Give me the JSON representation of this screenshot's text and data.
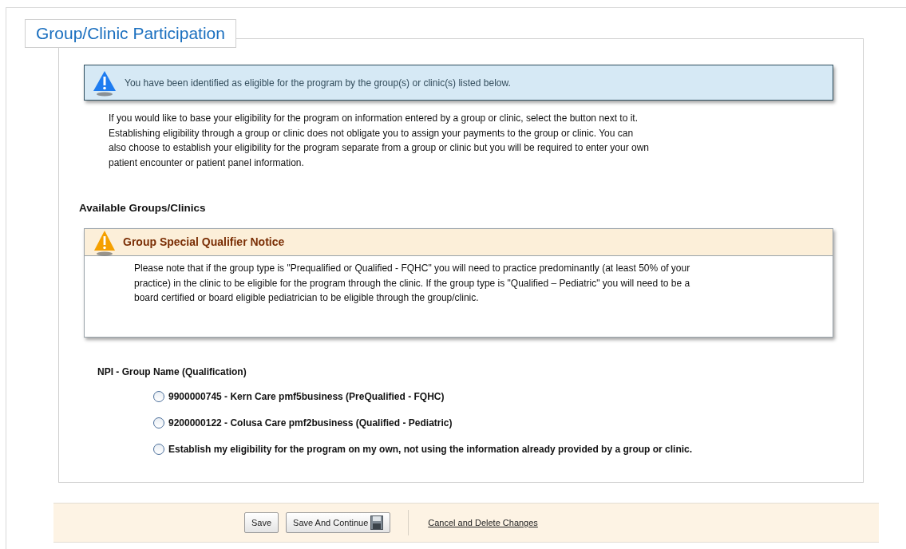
{
  "section_title": "Group/Clinic Participation",
  "info_message": "You have been identified as eligible for the program by the group(s) or clinic(s) listed below.",
  "intro_paragraph": "If you would like to base your eligibility for the program on information entered by a group or clinic, select the button next to it. Establishing eligibility through a group or clinic does not obligate you to assign your payments to the group or clinic. You can also choose to establish your eligibility for the program separate from a group or clinic but you will be required to enter your own patient encounter or patient panel information.",
  "available_heading": "Available Groups/Clinics",
  "notice": {
    "title": "Group Special Qualifier Notice",
    "body": "Please note that if the group type is \"Prequalified or Qualified - FQHC\" you will need to practice predominantly (at least 50% of your practice) in the clinic to be eligible for the program through the clinic. If the group type is \"Qualified – Pediatric\" you will need to be a board certified or board eligible pediatrician to be eligible through the group/clinic."
  },
  "options_label": "NPI - Group Name (Qualification)",
  "options": [
    {
      "label": "9900000745 - Kern Care pmf5business (PreQualified - FQHC)",
      "selected": false
    },
    {
      "label": "9200000122 - Colusa Care pmf2business (Qualified - Pediatric)",
      "selected": false
    },
    {
      "label": "Establish my eligibility for the program on my own, not using the information already provided by a group or clinic.",
      "selected": false
    }
  ],
  "footer": {
    "buttons": [
      {
        "label": "Save",
        "kind": "plain"
      },
      {
        "label": "Save And Continue",
        "kind": "save-icon"
      }
    ],
    "link": "Cancel and Delete Changes"
  }
}
